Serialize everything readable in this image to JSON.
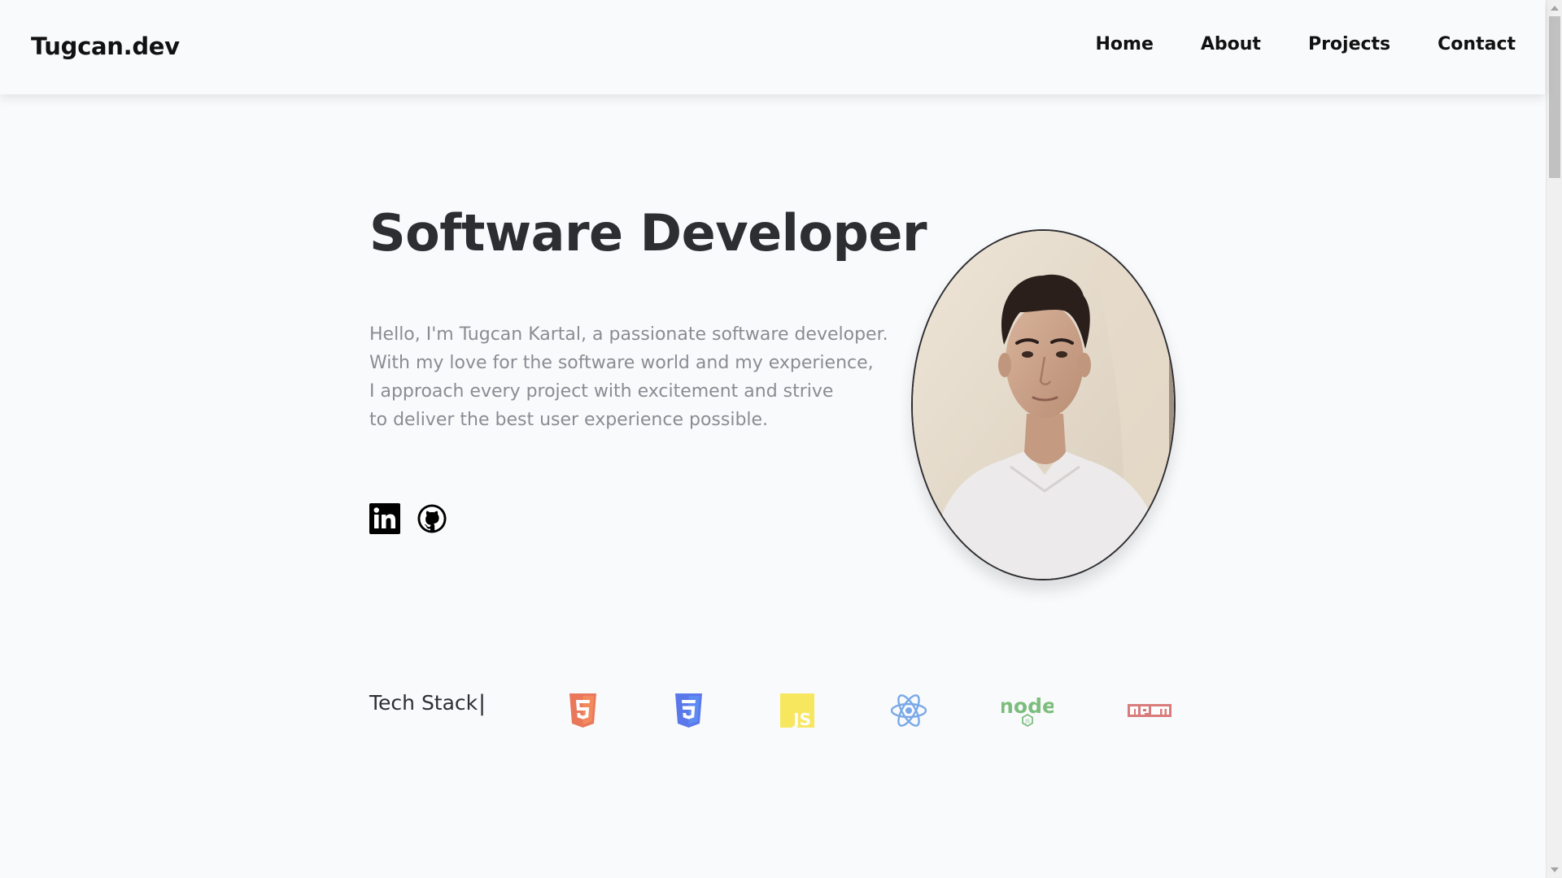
{
  "header": {
    "logo": "Tugcan.dev",
    "nav": [
      "Home",
      "About",
      "Projects",
      "Contact"
    ]
  },
  "hero": {
    "title": "Software Developer",
    "intro_lines": [
      "Hello, I'm Tugcan Kartal, a passionate software developer.",
      "With my love for the software world and my experience,",
      "I approach every project with excitement and strive",
      "to deliver the best user experience possible."
    ],
    "socials": [
      {
        "name": "linkedin-icon"
      },
      {
        "name": "github-icon"
      }
    ],
    "portrait": {
      "name": "profile-photo"
    }
  },
  "tech_stack": {
    "label": "Tech Stack",
    "separator": "|",
    "icons": [
      {
        "name": "html5-icon",
        "color": "#e44d26"
      },
      {
        "name": "css3-icon",
        "color": "#264de4"
      },
      {
        "name": "javascript-icon",
        "color": "#f7df1e"
      },
      {
        "name": "react-icon",
        "color": "#61dafb"
      },
      {
        "name": "nodejs-icon",
        "color": "#539e43"
      },
      {
        "name": "npm-icon",
        "color": "#cb3837"
      }
    ]
  },
  "colors": {
    "background": "#f9fafc",
    "heading": "#2d2e32",
    "body_text": "#8b8c92"
  }
}
